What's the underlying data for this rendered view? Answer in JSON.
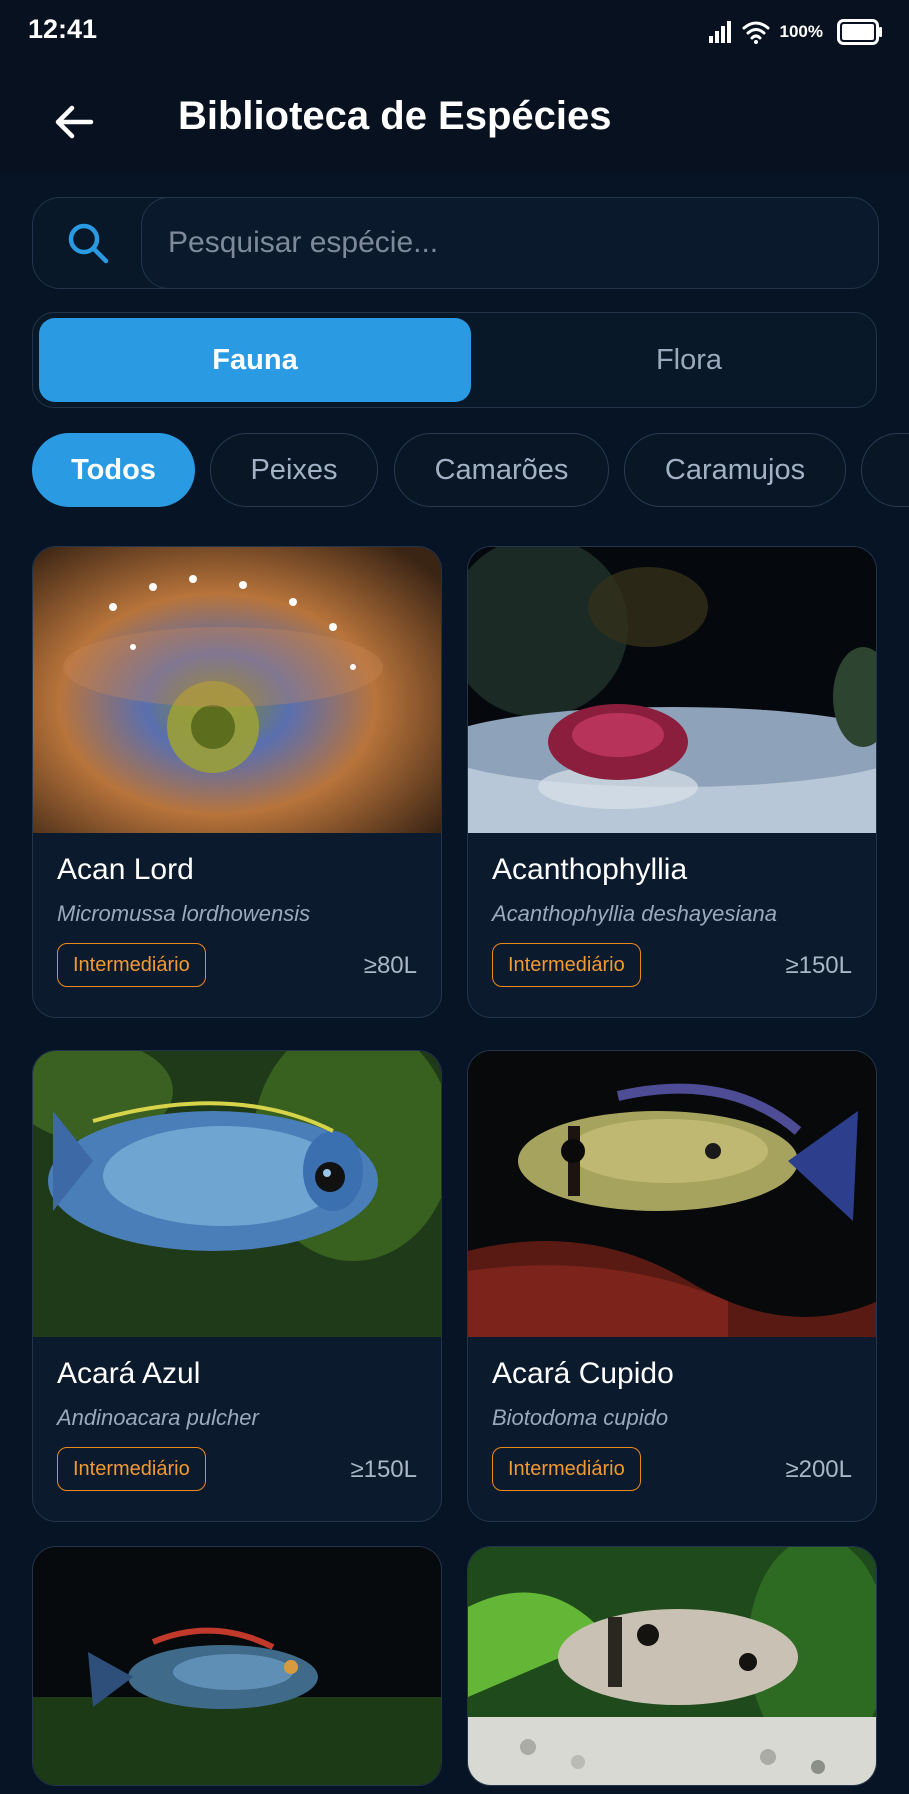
{
  "status_bar": {
    "time": "12:41",
    "battery": "100%"
  },
  "header": {
    "title": "Biblioteca de Espécies",
    "back_icon": "arrow-left-icon"
  },
  "search": {
    "placeholder": "Pesquisar espécie...",
    "value": "",
    "icon": "search-icon"
  },
  "segments": [
    {
      "label": "Fauna",
      "active": true
    },
    {
      "label": "Flora",
      "active": false
    }
  ],
  "filters": [
    {
      "label": "Todos",
      "active": true
    },
    {
      "label": "Peixes",
      "active": false
    },
    {
      "label": "Camarões",
      "active": false
    },
    {
      "label": "Caramujos",
      "active": false
    }
  ],
  "species": [
    {
      "name": "Acan Lord",
      "scientific": "Micromussa lordhowensis",
      "level": "Intermediário",
      "volume": "≥80L"
    },
    {
      "name": "Acanthophyllia",
      "scientific": "Acanthophyllia deshayesiana",
      "level": "Intermediário",
      "volume": "≥150L"
    },
    {
      "name": "Acará Azul",
      "scientific": "Andinoacara pulcher",
      "level": "Intermediário",
      "volume": "≥150L"
    },
    {
      "name": "Acará Cupido",
      "scientific": "Biotodoma cupido",
      "level": "Intermediário",
      "volume": "≥200L"
    }
  ],
  "colors": {
    "background": "#061426",
    "accent": "#2a9be3",
    "badge": "#e98a1f"
  }
}
